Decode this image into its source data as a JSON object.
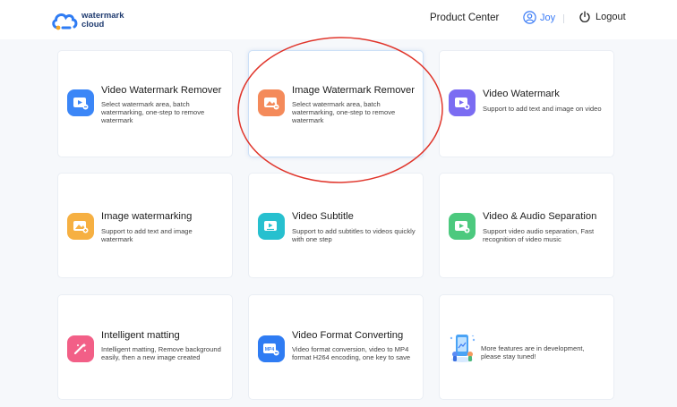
{
  "header": {
    "logo_line1": "watermark",
    "logo_line2": "cloud",
    "product_center": "Product Center",
    "username": "Joy",
    "logout": "Logout"
  },
  "features": [
    {
      "title": "Video Watermark Remover",
      "desc": "Select watermark area, batch watermarking, one-step to remove watermark",
      "icon": "video-watermark-remover-icon",
      "color": "#3b86f7"
    },
    {
      "title": "Image Watermark Remover",
      "desc": "Select watermark area, batch watermarking, one-step to remove watermark",
      "icon": "image-watermark-remover-icon",
      "color": "#f48a5a"
    },
    {
      "title": "Video Watermark",
      "desc": "Support to add text and image on video",
      "icon": "video-watermark-icon",
      "color": "#7b6cf2"
    },
    {
      "title": "Image watermarking",
      "desc": "Support to add text and image watermark",
      "icon": "image-watermarking-icon",
      "color": "#f6b042"
    },
    {
      "title": "Video Subtitle",
      "desc": "Support to add subtitles to videos quickly with one step",
      "icon": "video-subtitle-icon",
      "color": "#27c0cf"
    },
    {
      "title": "Video & Audio Separation",
      "desc": "Support video audio separation, Fast recognition of video music",
      "icon": "video-audio-separation-icon",
      "color": "#4cc97e"
    },
    {
      "title": "Intelligent matting",
      "desc": "Intelligent matting, Remove background easily, then a new image created",
      "icon": "intelligent-matting-icon",
      "color": "#f25f87"
    },
    {
      "title": "Video Format Converting",
      "desc": "Video format conversion, video to MP4 format H264 encoding, one key to save",
      "icon": "video-format-converting-icon",
      "color": "#2f7cf3"
    }
  ],
  "more": {
    "text": "More features are in development, please stay tuned!",
    "icon": "development-illustration-icon"
  },
  "colors": {
    "accent": "#3a7bf6",
    "annotation": "#e0352b"
  }
}
